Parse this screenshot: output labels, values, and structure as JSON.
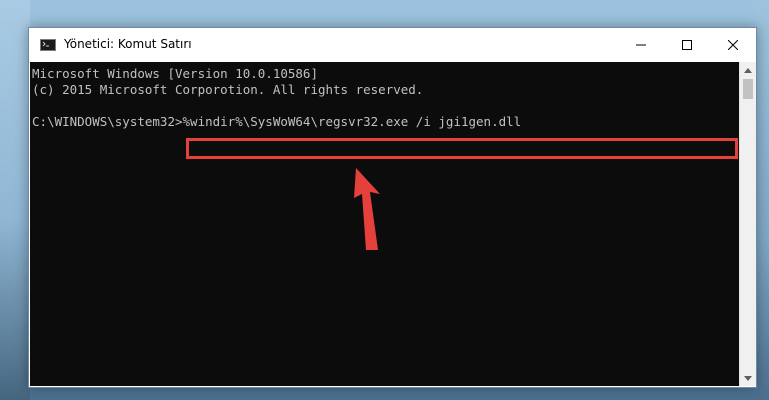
{
  "window": {
    "title": "Yönetici: Komut Satırı"
  },
  "console": {
    "lines": [
      "Microsoft Windows [Version 10.0.10586]",
      "(c) 2015 Microsoft Corporotion. All rights reserved.",
      "",
      "C:\\WINDOWS\\system32>"
    ],
    "prompt": "C:\\WINDOWS\\system32>",
    "command": "%windir%\\SysWoW64\\regsvr32.exe /i jgi1gen.dll"
  },
  "annotation": {
    "highlight_color": "#e5403c",
    "arrow_color": "#e5403c",
    "arrow_icon": "arrow-up-icon"
  },
  "colors": {
    "console_bg": "#0c0c0c",
    "console_text": "#c0c0c0"
  }
}
